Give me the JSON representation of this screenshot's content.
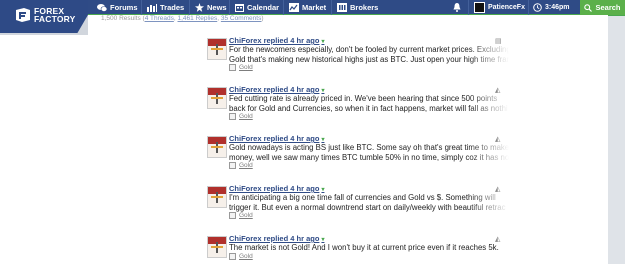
{
  "brand": {
    "line1": "FOREX",
    "line2": "FACTORY"
  },
  "nav": {
    "forums": "Forums",
    "trades": "Trades",
    "news": "News",
    "calendar": "Calendar",
    "market": "Market",
    "brokers": "Brokers"
  },
  "user": {
    "name": "PatienceFx",
    "time": "3:46pm"
  },
  "search": {
    "label": "Search"
  },
  "results": {
    "prefix": "1,500 Results (",
    "threads": "4 Threads",
    "replies": "1,461 Replies",
    "comments": "35 Comments",
    "suffix": ")"
  },
  "posts": [
    {
      "author": "ChiForex replied 4 hr ago",
      "line1": "For the newcomers especially, don't be fooled by current market prices. Excluding",
      "line2": "Gold that's making new historical highs just as BTC. Just open your high time fram",
      "tag": "Gold"
    },
    {
      "author": "ChiForex replied 4 hr ago",
      "line1": "Fed cutting rate is already priced in. We've been hearing that since 500 points",
      "line2": "back for Gold and Currencies, so when it in fact happens, market will fall as nothi",
      "tag": "Gold"
    },
    {
      "author": "ChiForex replied 4 hr ago",
      "line1": "Gold nowadays is acting BS just like BTC. Some say oh that's great time to make",
      "line2": "money, well we saw many times BTC tumble 50% in no time, simply coz it has no",
      "tag": "Gold"
    },
    {
      "author": "ChiForex replied 4 hr ago",
      "line1": "I'm anticipating a big one time fall of currencies and Gold vs $. Something will",
      "line2": "trigger it. But even a normal downtrend start on daily/weekly with beautiful retrac",
      "tag": "Gold"
    },
    {
      "author": "ChiForex replied 4 hr ago",
      "line1": "The market is not Gold! And I won't buy it at current price even if it reaches 5k.",
      "line2": "",
      "tag": "Gold"
    }
  ]
}
